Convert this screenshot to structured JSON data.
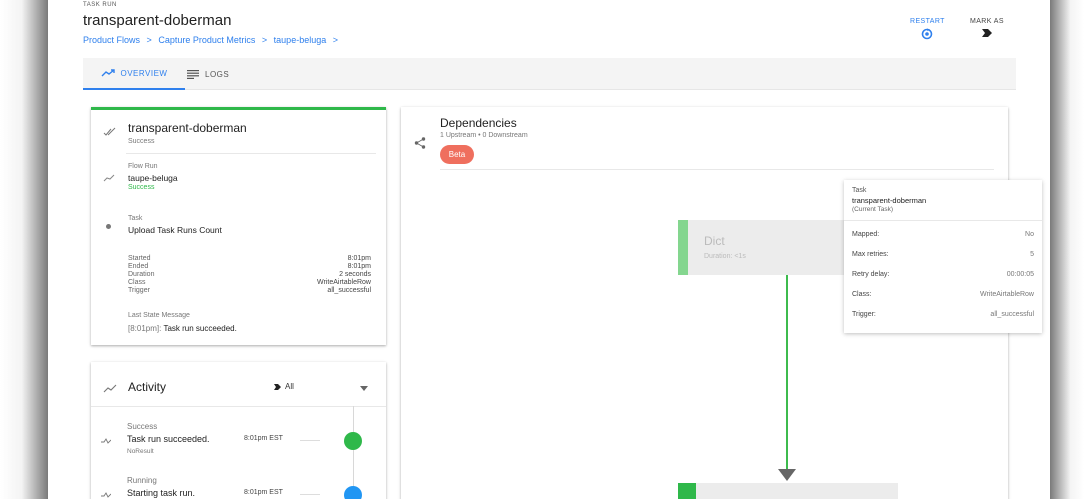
{
  "header": {
    "eyebrow": "TASK RUN",
    "title": "transparent-doberman",
    "breadcrumb": [
      "Product Flows",
      ">",
      "Capture Product Metrics",
      ">",
      "taupe-beluga",
      ">"
    ],
    "actions": {
      "restart": "RESTART",
      "mark_as": "MARK AS"
    }
  },
  "tabs": {
    "overview": "OVERVIEW",
    "logs": "LOGS"
  },
  "detail": {
    "task_name": "transparent-doberman",
    "task_state": "Success",
    "flow_run_label": "Flow Run",
    "flow_run_name": "taupe-beluga",
    "flow_run_state": "Success",
    "task_label": "Task",
    "task_title": "Upload Task Runs Count",
    "rows": [
      {
        "key": "Started",
        "value": "8:01pm"
      },
      {
        "key": "Ended",
        "value": "8:01pm"
      },
      {
        "key": "Duration",
        "value": "2 seconds"
      },
      {
        "key": "Class",
        "value": "WriteAirtableRow"
      },
      {
        "key": "Trigger",
        "value": "all_successful"
      }
    ],
    "last_state_label": "Last State Message",
    "last_state_time": "[8:01pm]:",
    "last_state_message": "Task run succeeded."
  },
  "activity": {
    "title": "Activity",
    "filter_label": "All",
    "entries": [
      {
        "state": "Success",
        "message": "Task run succeeded.",
        "sub": "NoResult",
        "time": "8:01pm EST",
        "color": "#2fb84a"
      },
      {
        "state": "Running",
        "message": "Starting task run.",
        "sub": "",
        "time": "8:01pm EST",
        "color": "#2196f3"
      }
    ]
  },
  "dependencies": {
    "title": "Dependencies",
    "subtitle": "1 Upstream • 0 Downstream",
    "beta": "Beta",
    "upstream_node": {
      "name": "Dict",
      "duration": "Duration: <1s"
    },
    "tooltip": {
      "label": "Task",
      "name": "transparent-doberman",
      "note": "(Current Task)",
      "rows": [
        {
          "key": "Mapped:",
          "value": "No"
        },
        {
          "key": "Max retries:",
          "value": "5"
        },
        {
          "key": "Retry delay:",
          "value": "00:00:05"
        },
        {
          "key": "Class:",
          "value": "WriteAirtableRow"
        },
        {
          "key": "Trigger:",
          "value": "all_successful"
        }
      ]
    }
  },
  "colors": {
    "accent": "#2f80ed",
    "success": "#2fb84a",
    "running": "#2196f3",
    "beta": "#ef6f5e",
    "edge": "#3dbb4d"
  }
}
